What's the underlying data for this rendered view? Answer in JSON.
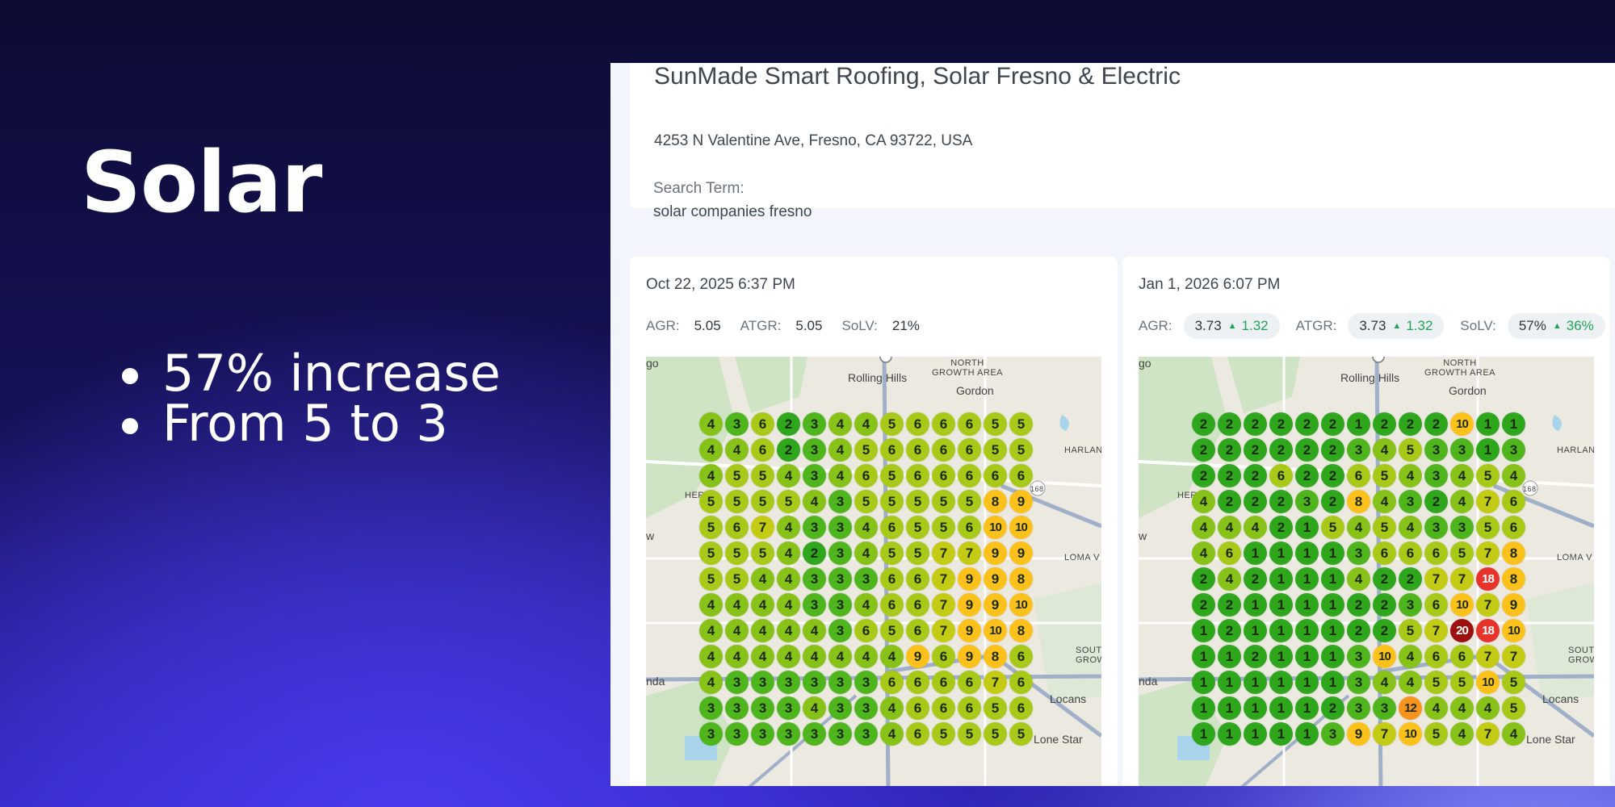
{
  "slide": {
    "title": "Solar",
    "bullets": [
      "57% increase",
      "From 5 to 3"
    ]
  },
  "business": {
    "name": "SunMade Smart Roofing, Solar Fresno & Electric",
    "address": "4253 N Valentine Ave, Fresno, CA 93722, USA"
  },
  "search": {
    "label": "Search Term:",
    "term": "solar companies fresno"
  },
  "map_labels": {
    "go": "go",
    "rolling_hills": "Rolling Hills",
    "north_growth_area": "NORTH\nGROWTH AREA",
    "gordon": "Gordon",
    "harlan": "HARLAN",
    "herndon": "HERN",
    "loma": "LOMA V",
    "south_growth": "SOUT\nGROW",
    "nda": "nda",
    "locans": "Locans",
    "lone_star": "Lone Star",
    "w": "w",
    "route": "168"
  },
  "scans": [
    {
      "date": "Oct 22, 2025 6:37 PM",
      "metrics": [
        {
          "label": "AGR:",
          "value": "5.05",
          "delta": null
        },
        {
          "label": "ATGR:",
          "value": "5.05",
          "delta": null
        },
        {
          "label": "SoLV:",
          "value": "21%",
          "delta": null
        }
      ],
      "grid": [
        [
          4,
          3,
          6,
          2,
          3,
          4,
          4,
          5,
          6,
          6,
          6,
          5,
          5
        ],
        [
          4,
          4,
          6,
          2,
          3,
          4,
          5,
          6,
          6,
          6,
          6,
          5,
          5
        ],
        [
          4,
          5,
          5,
          4,
          3,
          4,
          6,
          5,
          6,
          6,
          6,
          6,
          6
        ],
        [
          5,
          5,
          5,
          5,
          4,
          3,
          5,
          5,
          5,
          5,
          5,
          8,
          9
        ],
        [
          5,
          6,
          7,
          4,
          3,
          3,
          4,
          6,
          5,
          5,
          6,
          10,
          10
        ],
        [
          5,
          5,
          5,
          4,
          2,
          3,
          4,
          5,
          5,
          7,
          7,
          9,
          9
        ],
        [
          5,
          5,
          4,
          4,
          3,
          3,
          3,
          6,
          6,
          7,
          9,
          9,
          8
        ],
        [
          4,
          4,
          4,
          4,
          3,
          3,
          4,
          6,
          6,
          7,
          9,
          9,
          10
        ],
        [
          4,
          4,
          4,
          4,
          4,
          3,
          6,
          5,
          6,
          7,
          9,
          10,
          8
        ],
        [
          4,
          4,
          4,
          4,
          4,
          4,
          4,
          4,
          9,
          6,
          9,
          8,
          6
        ],
        [
          4,
          3,
          3,
          3,
          3,
          3,
          3,
          6,
          6,
          6,
          6,
          7,
          6
        ],
        [
          3,
          3,
          3,
          3,
          4,
          3,
          3,
          4,
          6,
          6,
          6,
          5,
          6
        ],
        [
          3,
          3,
          3,
          3,
          3,
          3,
          3,
          4,
          6,
          5,
          5,
          5,
          5
        ]
      ]
    },
    {
      "date": "Jan 1, 2026 6:07 PM",
      "metrics": [
        {
          "label": "AGR:",
          "value": "3.73",
          "delta": "1.32"
        },
        {
          "label": "ATGR:",
          "value": "3.73",
          "delta": "1.32"
        },
        {
          "label": "SoLV:",
          "value": "57%",
          "delta": "36%"
        }
      ],
      "grid": [
        [
          2,
          2,
          2,
          2,
          2,
          2,
          1,
          2,
          2,
          2,
          10,
          1,
          1
        ],
        [
          2,
          2,
          2,
          2,
          2,
          2,
          3,
          4,
          5,
          3,
          3,
          1,
          3
        ],
        [
          2,
          2,
          2,
          6,
          2,
          2,
          6,
          5,
          4,
          3,
          4,
          5,
          4
        ],
        [
          4,
          2,
          2,
          2,
          3,
          2,
          8,
          4,
          3,
          2,
          4,
          7,
          6
        ],
        [
          4,
          4,
          4,
          2,
          1,
          5,
          4,
          5,
          4,
          3,
          3,
          5,
          6
        ],
        [
          4,
          6,
          1,
          1,
          1,
          1,
          3,
          6,
          6,
          6,
          5,
          7,
          8
        ],
        [
          2,
          4,
          2,
          1,
          1,
          1,
          4,
          2,
          2,
          7,
          7,
          18,
          8
        ],
        [
          2,
          2,
          1,
          1,
          1,
          1,
          2,
          2,
          3,
          6,
          10,
          7,
          9
        ],
        [
          1,
          2,
          1,
          1,
          1,
          1,
          2,
          2,
          5,
          7,
          20,
          18,
          10
        ],
        [
          1,
          1,
          2,
          1,
          1,
          1,
          3,
          10,
          4,
          6,
          6,
          7,
          7
        ],
        [
          1,
          1,
          1,
          1,
          1,
          1,
          3,
          4,
          4,
          5,
          5,
          10,
          5
        ],
        [
          1,
          1,
          1,
          1,
          1,
          2,
          3,
          3,
          12,
          4,
          4,
          4,
          5
        ],
        [
          1,
          1,
          1,
          1,
          1,
          3,
          9,
          7,
          10,
          5,
          4,
          7,
          4
        ]
      ]
    }
  ],
  "rank_colors": {
    "1-2": "#2fa71d",
    "3": "#4fb51c",
    "4": "#86c218",
    "5-6": "#a8c918",
    "7": "#c4cb14",
    "8-10": "#fcc11a",
    "11-15": "#f7941d",
    "16-19": "#e8332a",
    "20+": "#9c1010"
  }
}
